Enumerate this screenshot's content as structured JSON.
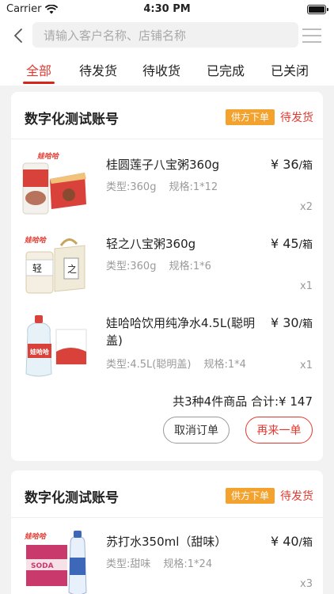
{
  "statusbar": {
    "carrier": "Carrier",
    "time": "4:30 PM"
  },
  "search": {
    "placeholder": "请输入客户名称、店铺名称"
  },
  "tabs": [
    {
      "label": "全部"
    },
    {
      "label": "待发货"
    },
    {
      "label": "待收货"
    },
    {
      "label": "已完成"
    },
    {
      "label": "已关闭"
    }
  ],
  "colors": {
    "accent": "#e03a30",
    "badge": "#f4a22e",
    "background": "#f2f2f2"
  },
  "orders": [
    {
      "shop": "数字化测试账号",
      "badge": "供方下单",
      "status": "待发货",
      "items": [
        {
          "name": "桂圆莲子八宝粥360g",
          "price": "¥ 36",
          "unit": "/箱",
          "type": "类型:360g",
          "spec": "规格:1*12",
          "qty": "x2",
          "logo": "娃哈哈"
        },
        {
          "name": "轻之八宝粥360g",
          "price": "¥ 45",
          "unit": "/箱",
          "type": "类型:360g",
          "spec": "规格:1*6",
          "qty": "x1",
          "logo": "娃哈哈"
        },
        {
          "name": "娃哈哈饮用纯净水4.5L(聪明盖)",
          "price": "¥ 30",
          "unit": "/箱",
          "type": "类型:4.5L(聪明盖)",
          "spec": "规格:1*4",
          "qty": "x1",
          "logo": "娃哈哈"
        }
      ],
      "summary": "共3种4件商品  合计:¥ 147",
      "cancel_label": "取消订单",
      "again_label": "再来一单"
    },
    {
      "shop": "数字化测试账号",
      "badge": "供方下单",
      "status": "待发货",
      "items": [
        {
          "name": "苏打水350ml（甜味）",
          "price": "¥ 40",
          "unit": "/箱",
          "type": "类型:甜味",
          "spec": "规格:1*24",
          "qty": "x3",
          "logo": "娃哈哈",
          "box_text": "SODA"
        }
      ]
    }
  ]
}
